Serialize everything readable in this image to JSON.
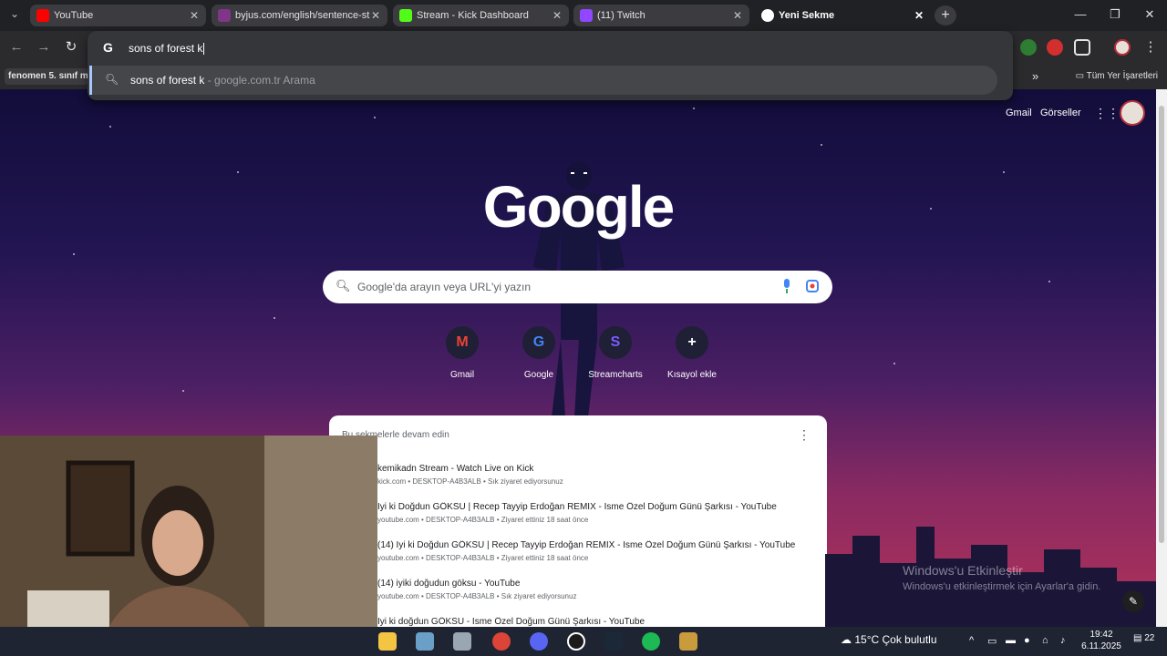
{
  "browser": {
    "tabs": [
      {
        "label": "YouTube",
        "icon": "youtube-icon",
        "color": "#ff0000"
      },
      {
        "label": "byjus.com/english/sentence-st",
        "icon": "byjus-icon",
        "color": "#813588"
      },
      {
        "label": "Stream - Kick Dashboard",
        "icon": "kick-icon",
        "color": "#53fc18"
      },
      {
        "label": "(11) Twitch",
        "icon": "twitch-icon",
        "color": "#9146ff"
      },
      {
        "label": "Yeni Sekme",
        "icon": "newtab-icon",
        "color": "#ffffff"
      }
    ],
    "omnibox": {
      "query": "sons of forest k",
      "suggestion": "sons of forest k",
      "suggestion_suffix": " - google.com.tr Arama"
    },
    "bookmarks": {
      "first": "fenomen 5. sınıf m",
      "all_bookmarks": "Tüm Yer İşaretleri"
    }
  },
  "newtab": {
    "top_links": {
      "gmail": "Gmail",
      "images": "Görseller"
    },
    "logo": "Google",
    "search_placeholder": "Google'da arayın veya URL'yi yazın",
    "shortcuts": [
      {
        "label": "Gmail",
        "glyph": "M"
      },
      {
        "label": "Google",
        "glyph": "G"
      },
      {
        "label": "Streamcharts",
        "glyph": "S"
      },
      {
        "label": "Kısayol ekle",
        "glyph": "+"
      }
    ],
    "continue_header": "Bu sekmelerle devam edin",
    "recent": [
      {
        "title": "kemikadn Stream - Watch Live on Kick",
        "sub": "kick.com • DESKTOP-A4B3ALB • Sık ziyaret ediyorsunuz"
      },
      {
        "title": "İyi ki Doğdun GÖKSU | Recep Tayyip Erdoğan REMİX - İsme Özel Doğum Günü Şarkısı - YouTube",
        "sub": "youtube.com • DESKTOP-A4B3ALB • Ziyaret ettiniz 18 saat önce"
      },
      {
        "title": "(14) İyi ki Doğdun GÖKSU | Recep Tayyip Erdoğan REMİX - İsme Özel Doğum Günü Şarkısı - YouTube",
        "sub": "youtube.com • DESKTOP-A4B3ALB • Ziyaret ettiniz 18 saat önce"
      },
      {
        "title": "(14) iyiki doğudun göksu - YouTube",
        "sub": "youtube.com • DESKTOP-A4B3ALB • Sık ziyaret ediyorsunuz"
      },
      {
        "title": "İyi ki doğdun GÖKSU - İsme Özel Doğum Günü Şarkısı - YouTube",
        "sub": ""
      }
    ],
    "activate_title": "Windows'u Etkinleştir",
    "activate_sub": "Windows'u etkinleştirmek için Ayarlar'a gidin."
  },
  "taskbar": {
    "weather": "15°C  Çok bulutlu",
    "time": "19:42",
    "date": "6.11.2025",
    "notifications": "22"
  }
}
